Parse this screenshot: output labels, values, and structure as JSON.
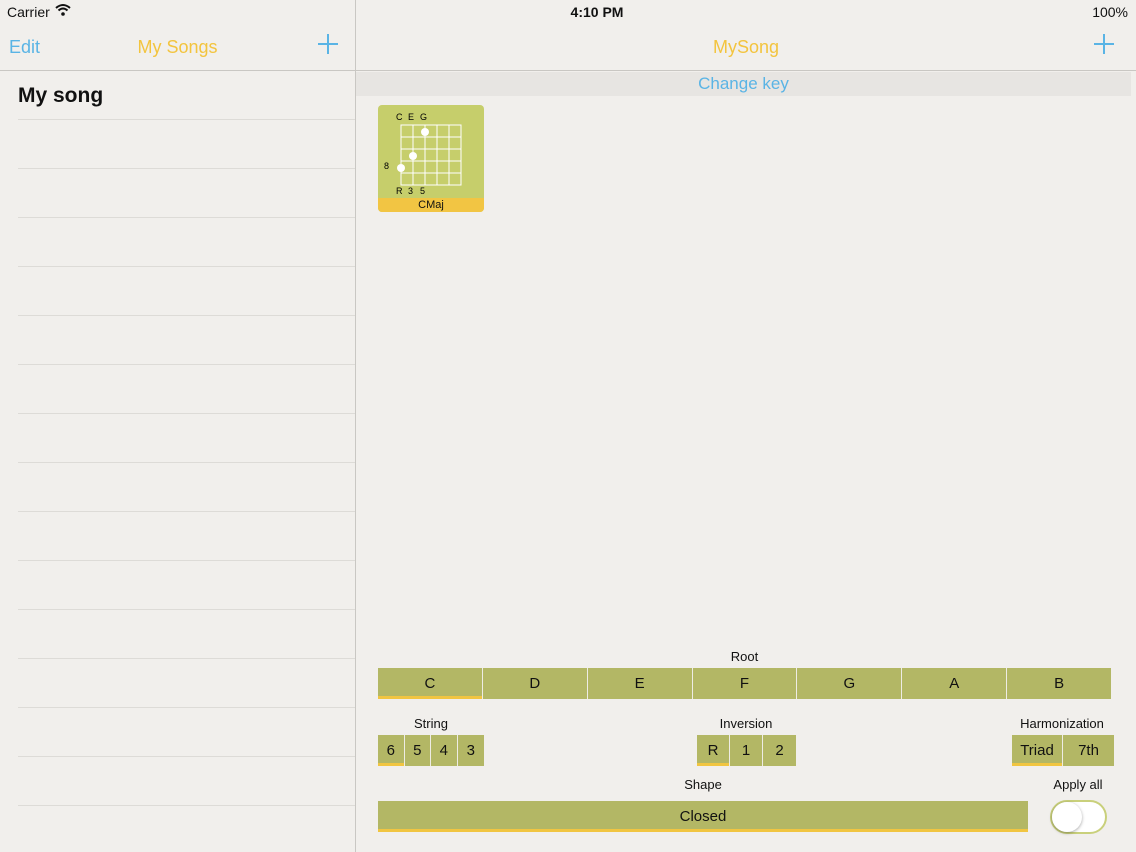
{
  "status": {
    "carrier": "Carrier",
    "time": "4:10 PM",
    "battery": "100%"
  },
  "master": {
    "edit_label": "Edit",
    "title": "My Songs",
    "songs": [
      "My song"
    ]
  },
  "detail": {
    "title": "MySong",
    "change_key": "Change key",
    "chord": {
      "name": "CMaj",
      "notes": [
        "C",
        "E",
        "G"
      ],
      "fret": "8",
      "degrees": [
        "R",
        "3",
        "5"
      ]
    },
    "root": {
      "label": "Root",
      "options": [
        "C",
        "D",
        "E",
        "F",
        "G",
        "A",
        "B"
      ],
      "selected": "C"
    },
    "string": {
      "label": "String",
      "options": [
        "6",
        "5",
        "4",
        "3"
      ],
      "selected": "6"
    },
    "inversion": {
      "label": "Inversion",
      "options": [
        "R",
        "1",
        "2"
      ],
      "selected": "R"
    },
    "harmonization": {
      "label": "Harmonization",
      "options": [
        "Triad",
        "7th"
      ],
      "selected": "Triad"
    },
    "shape": {
      "label": "Shape",
      "value": "Closed"
    },
    "apply_all": {
      "label": "Apply all",
      "on": false
    }
  },
  "colors": {
    "accent_blue": "#5ab4e5",
    "title_yellow": "#f3c43e",
    "segment_olive": "#b3b765",
    "chord_card": "#c6ce6b",
    "selected_underline": "#f1c541"
  }
}
